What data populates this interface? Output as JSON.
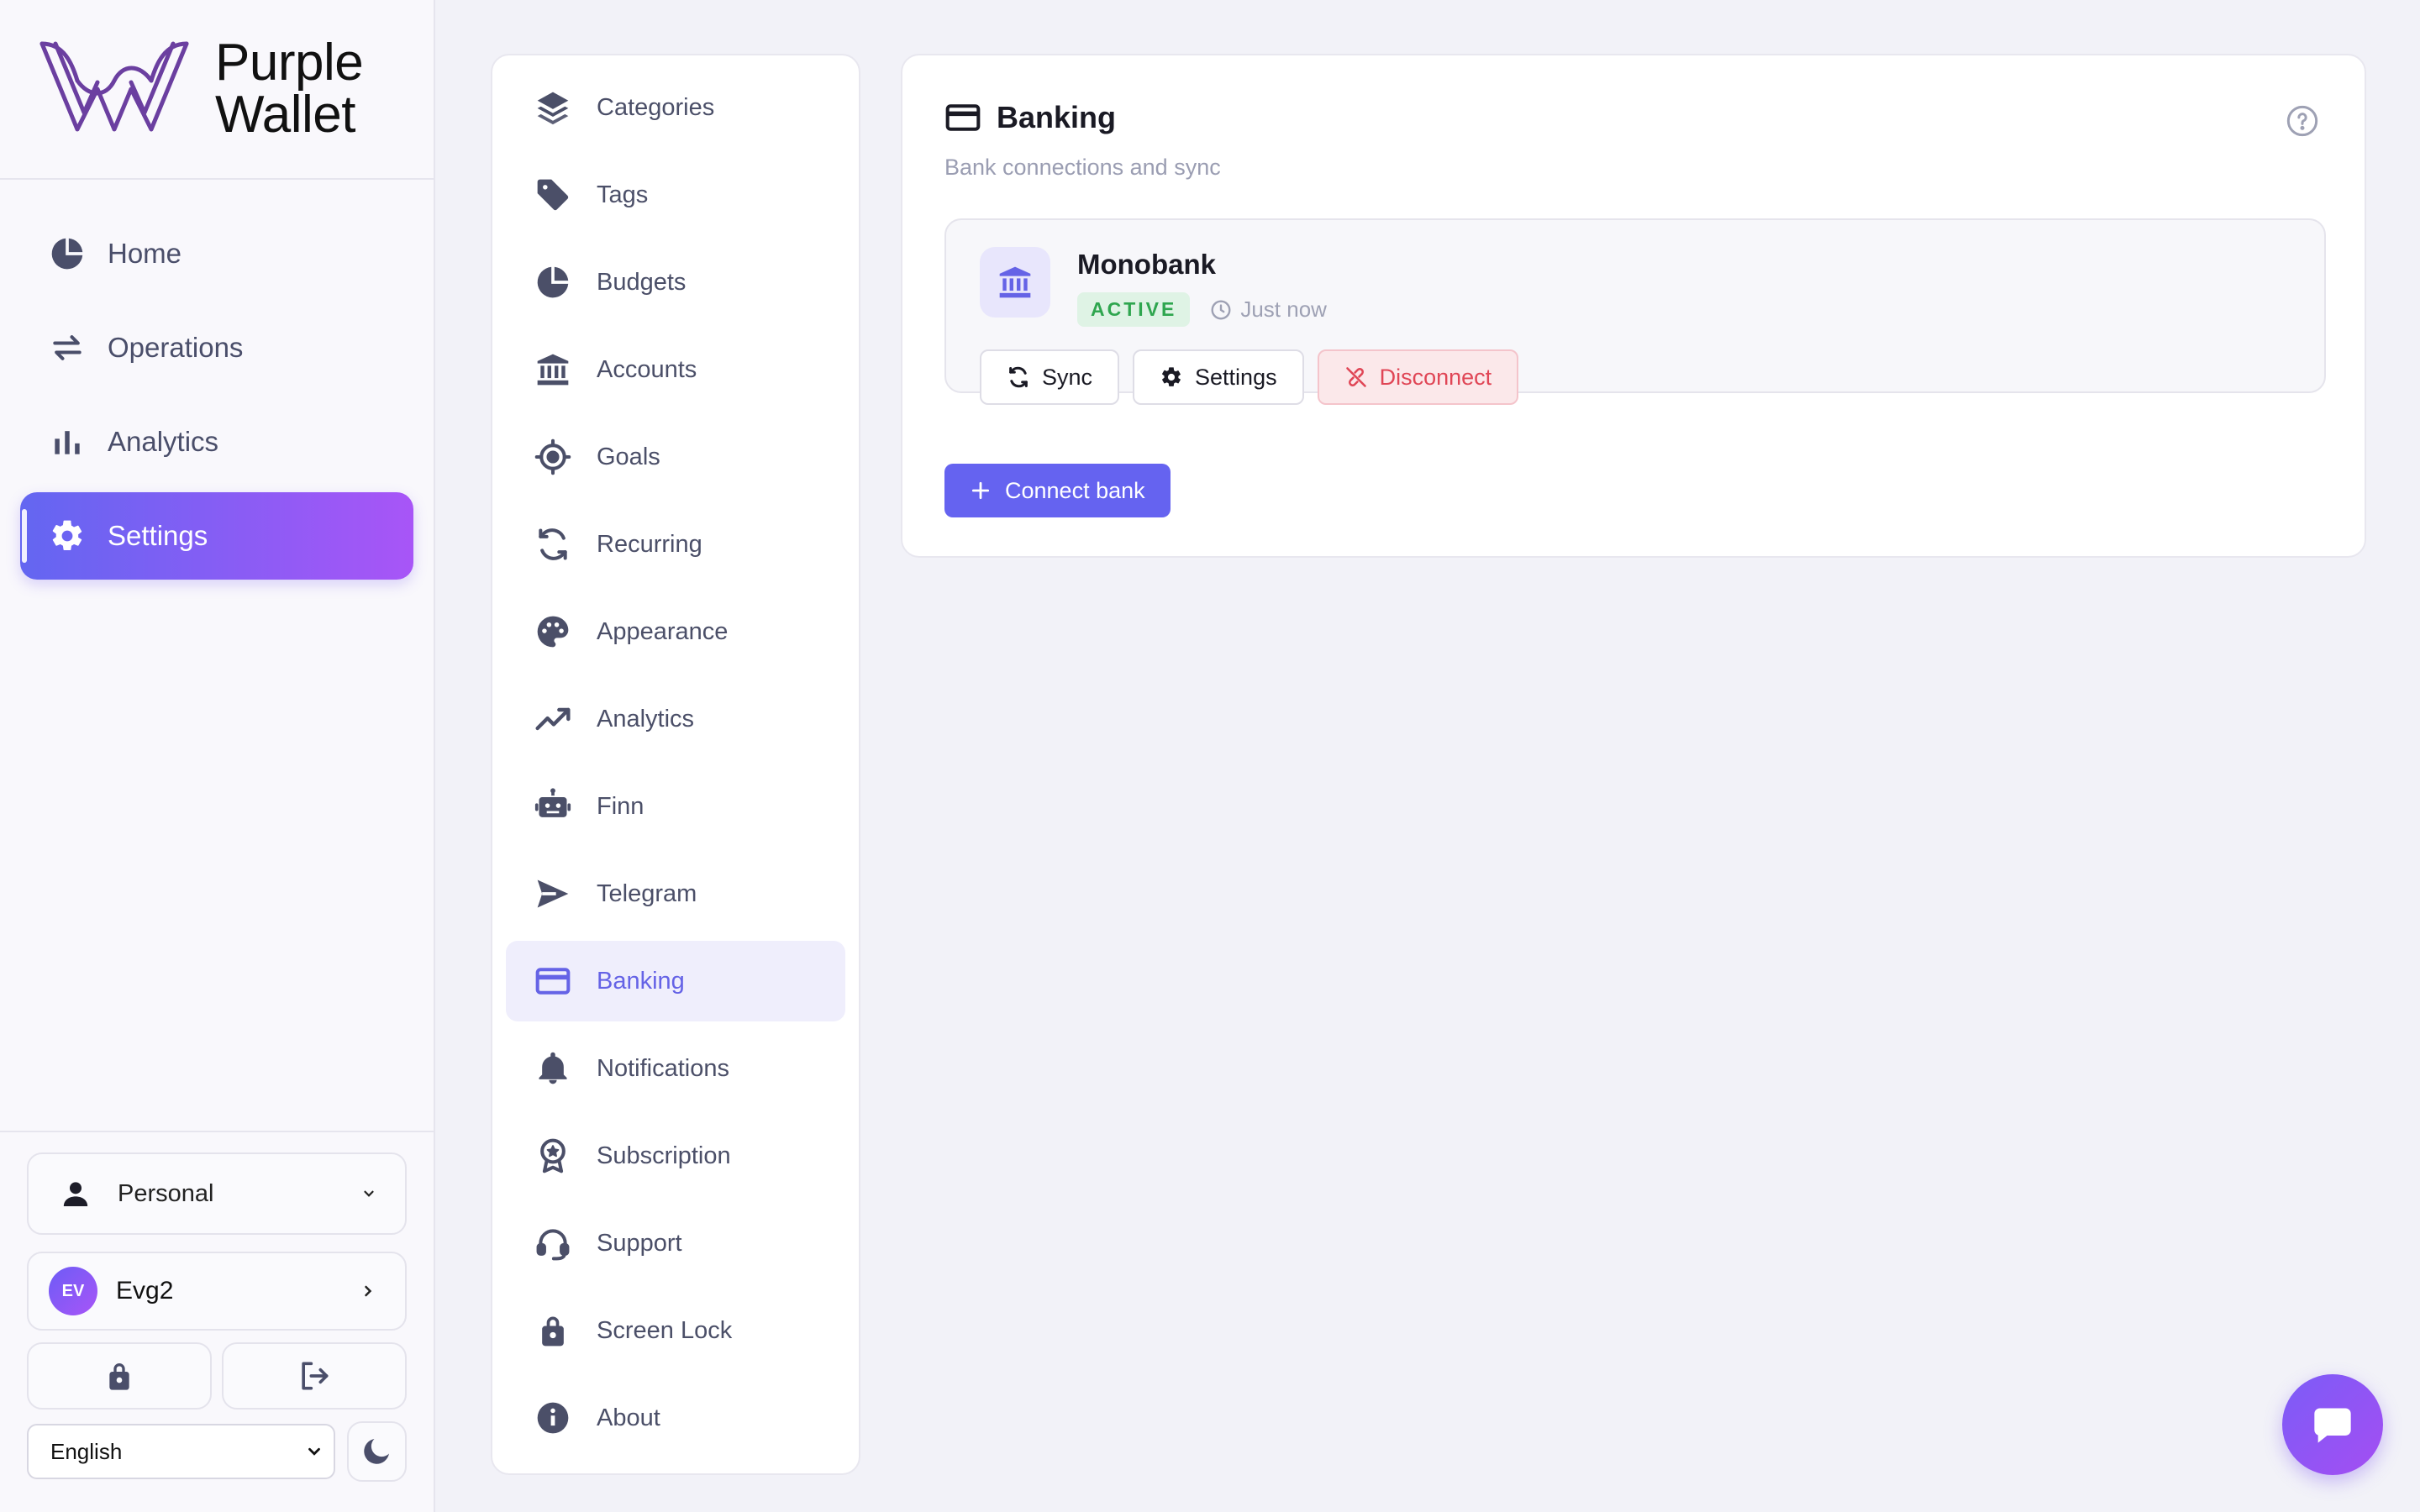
{
  "brand": {
    "line1": "Purple",
    "line2": "Wallet",
    "logo_icon": "purple-wallet-w-logo",
    "accent": "#6b3fa0"
  },
  "nav": {
    "items": [
      {
        "label": "Home",
        "icon": "pie-chart-icon"
      },
      {
        "label": "Operations",
        "icon": "arrows-swap-icon"
      },
      {
        "label": "Analytics",
        "icon": "bar-chart-icon"
      },
      {
        "label": "Settings",
        "icon": "gear-icon",
        "active": true
      }
    ]
  },
  "sidebar_bottom": {
    "workspace": {
      "label": "Personal",
      "icon": "person-icon"
    },
    "user": {
      "initials": "EV",
      "name": "Evg2"
    },
    "lock_icon": "lock-icon",
    "logout_icon": "logout-icon",
    "language": {
      "selected": "English"
    },
    "theme_icon": "moon-icon"
  },
  "settings_menu": {
    "items": [
      {
        "label": "Categories",
        "icon": "layers-icon"
      },
      {
        "label": "Tags",
        "icon": "tag-icon"
      },
      {
        "label": "Budgets",
        "icon": "pie-chart-icon"
      },
      {
        "label": "Accounts",
        "icon": "bank-icon"
      },
      {
        "label": "Goals",
        "icon": "target-icon"
      },
      {
        "label": "Recurring",
        "icon": "refresh-icon"
      },
      {
        "label": "Appearance",
        "icon": "palette-icon"
      },
      {
        "label": "Analytics",
        "icon": "line-chart-icon"
      },
      {
        "label": "Finn",
        "icon": "robot-icon"
      },
      {
        "label": "Telegram",
        "icon": "send-icon"
      },
      {
        "label": "Banking",
        "icon": "credit-card-icon",
        "active": true
      },
      {
        "label": "Notifications",
        "icon": "bell-icon"
      },
      {
        "label": "Subscription",
        "icon": "award-icon"
      },
      {
        "label": "Support",
        "icon": "headset-icon"
      },
      {
        "label": "Screen Lock",
        "icon": "lock-icon"
      },
      {
        "label": "About",
        "icon": "info-icon"
      }
    ]
  },
  "banking": {
    "title": "Banking",
    "subtitle": "Bank connections and sync",
    "help_icon": "help-circle-icon",
    "connection": {
      "name": "Monobank",
      "status": "ACTIVE",
      "last_sync": "Just now",
      "actions": {
        "sync": "Sync",
        "settings": "Settings",
        "disconnect": "Disconnect"
      }
    },
    "connect_button": "Connect bank"
  },
  "chat_icon": "chat-bubble-icon",
  "colors": {
    "primary": "#6563f0",
    "gradient_start": "#6366f1",
    "gradient_end": "#a855f7",
    "active_green": "#2fa64f",
    "danger": "#e04656",
    "muted_text": "#9a9db2"
  }
}
